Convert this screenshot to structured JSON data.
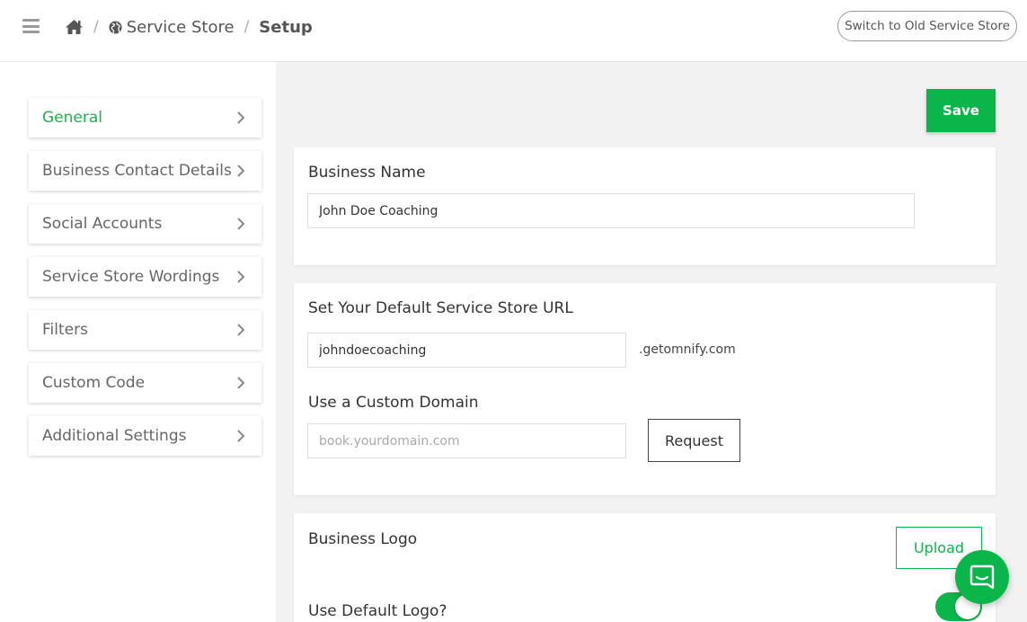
{
  "header": {
    "breadcrumb": {
      "home_icon": "home-icon",
      "separator": "/",
      "service_store_icon": "globe-icon",
      "service_store": "Service Store",
      "current": "Setup"
    },
    "switch_button": "Switch to Old Service Store"
  },
  "sidebar": {
    "items": [
      {
        "label": "General",
        "active": true
      },
      {
        "label": "Business Contact Details",
        "active": false
      },
      {
        "label": "Social Accounts",
        "active": false
      },
      {
        "label": "Service Store Wordings",
        "active": false
      },
      {
        "label": "Filters",
        "active": false
      },
      {
        "label": "Custom Code",
        "active": false
      },
      {
        "label": "Additional Settings",
        "active": false
      }
    ]
  },
  "main": {
    "save_label": "Save",
    "business_name": {
      "label": "Business Name",
      "value": "John Doe Coaching"
    },
    "store_url": {
      "label": "Set Your Default Service Store URL",
      "value": "johndoecoaching",
      "suffix": ".getomnify.com"
    },
    "custom_domain": {
      "label": "Use a Custom Domain",
      "placeholder": "book.yourdomain.com",
      "request_label": "Request"
    },
    "logo": {
      "label": "Business Logo",
      "upload_label": "Upload",
      "default_logo_label": "Use Default Logo?",
      "default_logo_enabled": true
    }
  },
  "colors": {
    "accent": "#0ab54a",
    "active_nav": "#1ab34a",
    "main_bg": "#f2f2f2"
  }
}
